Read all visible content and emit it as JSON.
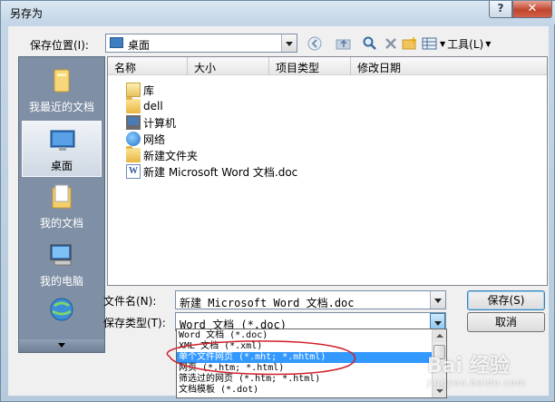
{
  "window": {
    "title": "另存为",
    "help_label": "?",
    "close_label": "✕"
  },
  "location": {
    "label": "保存位置(I):",
    "value": "桌面"
  },
  "toolbar": {
    "back_icon": "back-icon",
    "up_icon": "up-folder-icon",
    "tools_label": "工具(L)"
  },
  "places": {
    "items": [
      {
        "label": "我最近的文档",
        "icon": "recent-documents-icon",
        "selected": false
      },
      {
        "label": "桌面",
        "icon": "desktop-icon",
        "selected": true
      },
      {
        "label": "我的文档",
        "icon": "my-documents-icon",
        "selected": false
      },
      {
        "label": "我的电脑",
        "icon": "my-computer-icon",
        "selected": false
      }
    ]
  },
  "filelist": {
    "columns": [
      "名称",
      "大小",
      "项目类型",
      "修改日期"
    ],
    "items": [
      {
        "name": "库",
        "icon": "library-icon"
      },
      {
        "name": "dell",
        "icon": "folder-icon"
      },
      {
        "name": "计算机",
        "icon": "computer-icon"
      },
      {
        "name": "网络",
        "icon": "network-icon"
      },
      {
        "name": "新建文件夹",
        "icon": "folder-icon"
      },
      {
        "name": "新建 Microsoft Word 文档.doc",
        "icon": "word-document-icon"
      }
    ]
  },
  "filename": {
    "label": "文件名(N):",
    "value": "新建 Microsoft Word 文档.doc"
  },
  "filetype": {
    "label": "保存类型(T):",
    "value": "Word 文档 (*.doc)",
    "options": [
      "Word 文档 (*.doc)",
      "XML 文档 (*.xml)",
      "单个文件网页 (*.mht; *.mhtml)",
      "网页 (*.htm; *.html)",
      "筛选过的网页 (*.htm; *.html)",
      "文档模板 (*.dot)"
    ],
    "selected_index": 2
  },
  "buttons": {
    "save": "保存(S)",
    "cancel": "取消"
  },
  "watermark": {
    "text": "Bai 经验",
    "sub": "jingyan.baidu.com"
  },
  "colors": {
    "selection": "#3399ff",
    "annotation": "#d0202a",
    "title_bar": "#c2d4e6"
  }
}
